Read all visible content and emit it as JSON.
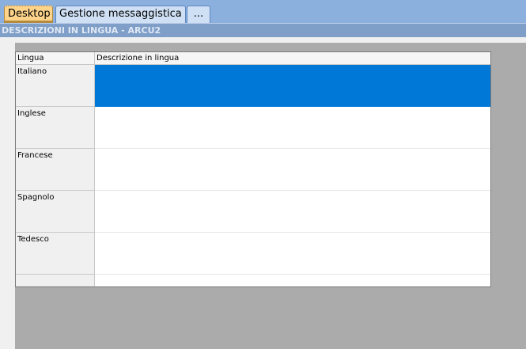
{
  "tabs": [
    {
      "label": "Desktop",
      "active": true
    },
    {
      "label": "Gestione messaggistica",
      "active": false
    },
    {
      "label": "...",
      "active": false
    }
  ],
  "page_title": "DESCRIZIONI IN LINGUA - ARCU2",
  "grid": {
    "columns": [
      "Lingua",
      "Descrizione in lingua"
    ],
    "rows": [
      {
        "lingua": "Italiano",
        "descrizione": "",
        "selected": true
      },
      {
        "lingua": "Inglese",
        "descrizione": ""
      },
      {
        "lingua": "Francese",
        "descrizione": ""
      },
      {
        "lingua": "Spagnolo",
        "descrizione": ""
      },
      {
        "lingua": "Tedesco",
        "descrizione": ""
      },
      {
        "lingua": "",
        "descrizione": ""
      }
    ]
  },
  "colors": {
    "tab_strip": "#8cb0de",
    "active_tab": "#fdd48a",
    "title_bar": "#7f9fc8",
    "selection": "#0078d7",
    "content_background": "#ababab"
  }
}
